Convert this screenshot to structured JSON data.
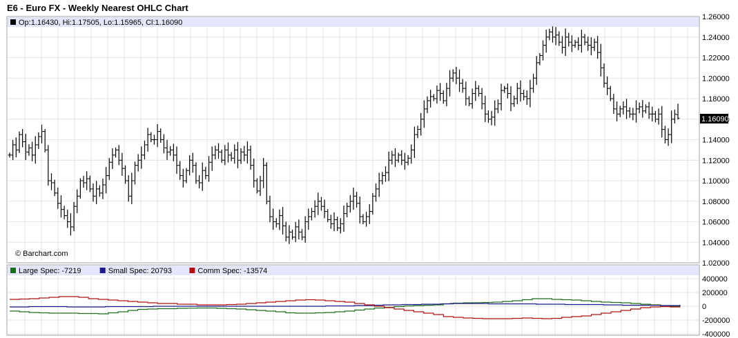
{
  "title": "E6 - Euro FX - Weekly Nearest OHLC Chart",
  "watermark": "© Barchart.com",
  "ohlc_legend": "Op:1.16430, Hi:1.17505, Lo:1.15965, Cl:1.16090",
  "last_price_label": "1.16090",
  "colors": {
    "legend_band": "#e4e6fb",
    "grid": "#e3e3e3",
    "bars": "#000000",
    "large_spec": "#1a6e1a",
    "small_spec": "#1a1a8c",
    "comm_spec": "#b01010"
  },
  "chart_data": [
    {
      "type": "ohlc",
      "yticks": [
        "1.26000",
        "1.24000",
        "1.22000",
        "1.20000",
        "1.18000",
        "1.16000",
        "1.14000",
        "1.12000",
        "1.10000",
        "1.08000",
        "1.06000",
        "1.04000",
        "1.02000"
      ],
      "ylim": [
        1.02,
        1.26
      ],
      "last": {
        "open": 1.1643,
        "high": 1.17505,
        "low": 1.15965,
        "close": 1.1609
      },
      "closes": [
        1.125,
        1.135,
        1.13,
        1.145,
        1.138,
        1.128,
        1.132,
        1.125,
        1.135,
        1.143,
        1.148,
        1.13,
        1.1,
        1.098,
        1.088,
        1.078,
        1.072,
        1.066,
        1.06,
        1.055,
        1.075,
        1.085,
        1.1,
        1.098,
        1.102,
        1.092,
        1.085,
        1.092,
        1.088,
        1.096,
        1.105,
        1.118,
        1.125,
        1.13,
        1.12,
        1.112,
        1.1,
        1.085,
        1.1,
        1.115,
        1.12,
        1.125,
        1.135,
        1.145,
        1.14,
        1.14,
        1.148,
        1.14,
        1.132,
        1.128,
        1.13,
        1.125,
        1.115,
        1.105,
        1.1,
        1.11,
        1.12,
        1.115,
        1.1,
        1.098,
        1.11,
        1.105,
        1.118,
        1.125,
        1.13,
        1.128,
        1.12,
        1.13,
        1.125,
        1.122,
        1.13,
        1.12,
        1.128,
        1.125,
        1.13,
        1.115,
        1.1,
        1.09,
        1.1,
        1.115,
        1.08,
        1.065,
        1.06,
        1.058,
        1.066,
        1.056,
        1.045,
        1.05,
        1.045,
        1.055,
        1.05,
        1.045,
        1.06,
        1.065,
        1.07,
        1.075,
        1.08,
        1.075,
        1.07,
        1.062,
        1.058,
        1.062,
        1.054,
        1.058,
        1.068,
        1.075,
        1.08,
        1.085,
        1.078,
        1.065,
        1.06,
        1.065,
        1.07,
        1.085,
        1.092,
        1.1,
        1.105,
        1.108,
        1.12,
        1.125,
        1.12,
        1.125,
        1.12,
        1.118,
        1.122,
        1.13,
        1.145,
        1.15,
        1.16,
        1.17,
        1.178,
        1.182,
        1.18,
        1.188,
        1.185,
        1.178,
        1.19,
        1.2,
        1.205,
        1.2,
        1.195,
        1.19,
        1.18,
        1.175,
        1.185,
        1.19,
        1.185,
        1.175,
        1.165,
        1.16,
        1.162,
        1.17,
        1.175,
        1.188,
        1.19,
        1.185,
        1.175,
        1.18,
        1.19,
        1.185,
        1.182,
        1.18,
        1.19,
        1.2,
        1.215,
        1.222,
        1.232,
        1.24,
        1.245,
        1.24,
        1.242,
        1.235,
        1.23,
        1.24,
        1.235,
        1.232,
        1.235,
        1.232,
        1.24,
        1.235,
        1.232,
        1.23,
        1.235,
        1.225,
        1.21,
        1.195,
        1.19,
        1.18,
        1.17,
        1.165,
        1.17,
        1.172,
        1.168,
        1.165,
        1.165,
        1.17,
        1.172,
        1.168,
        1.172,
        1.165,
        1.165,
        1.16,
        1.165,
        1.15,
        1.14,
        1.145,
        1.16,
        1.165,
        1.1609
      ]
    },
    {
      "type": "line",
      "yticks": [
        "400000",
        "200000",
        "0",
        "-200000",
        "-400000"
      ],
      "ylim": [
        -400000,
        400000
      ],
      "series": [
        {
          "name": "Large Spec: -7219",
          "color_key": "large_spec",
          "values": [
            -70000,
            -80000,
            -90000,
            -95000,
            -100000,
            -100000,
            -100000,
            -105000,
            -105000,
            -110000,
            -95000,
            -80000,
            -60000,
            -45000,
            -40000,
            -35000,
            -35000,
            -30000,
            -28000,
            -25000,
            -25000,
            -30000,
            -35000,
            -40000,
            -50000,
            -60000,
            -70000,
            -80000,
            -95000,
            -100000,
            -100000,
            -95000,
            -90000,
            -80000,
            -70000,
            -55000,
            -40000,
            -25000,
            -15000,
            -5000,
            5000,
            10000,
            15000,
            20000,
            35000,
            45000,
            50000,
            52000,
            55000,
            60000,
            70000,
            80000,
            95000,
            110000,
            110000,
            100000,
            95000,
            90000,
            80000,
            70000,
            60000,
            55000,
            50000,
            40000,
            30000,
            20000,
            10000,
            0,
            -5000
          ]
        },
        {
          "name": "Small Spec: 20793",
          "color_key": "small_spec",
          "values": [
            -10000,
            -10000,
            -5000,
            -5000,
            -5000,
            -5000,
            -10000,
            -10000,
            -10000,
            -10000,
            -5000,
            -5000,
            -5000,
            -5000,
            -5000,
            0,
            0,
            0,
            0,
            0,
            0,
            0,
            0,
            0,
            0,
            0,
            0,
            0,
            0,
            0,
            0,
            0,
            0,
            5000,
            5000,
            5000,
            10000,
            10000,
            15000,
            20000,
            20000,
            25000,
            25000,
            30000,
            30000,
            35000,
            40000,
            40000,
            40000,
            40000,
            35000,
            35000,
            35000,
            35000,
            35000,
            30000,
            30000,
            30000,
            25000,
            25000,
            25000,
            25000,
            20000,
            20000,
            15000,
            15000,
            15000,
            15000,
            10000,
            10000,
            20793
          ]
        },
        {
          "name": "Comm Spec: -13574",
          "color_key": "comm_spec",
          "values": [
            100000,
            105000,
            110000,
            120000,
            130000,
            140000,
            140000,
            130000,
            110000,
            100000,
            90000,
            80000,
            70000,
            60000,
            50000,
            40000,
            40000,
            30000,
            30000,
            20000,
            20000,
            20000,
            25000,
            30000,
            40000,
            50000,
            60000,
            70000,
            80000,
            90000,
            95000,
            90000,
            80000,
            70000,
            60000,
            40000,
            20000,
            0,
            -20000,
            -40000,
            -60000,
            -80000,
            -100000,
            -120000,
            -150000,
            -160000,
            -170000,
            -175000,
            -180000,
            -180000,
            -180000,
            -175000,
            -170000,
            -175000,
            -180000,
            -175000,
            -160000,
            -150000,
            -140000,
            -120000,
            -100000,
            -80000,
            -60000,
            -40000,
            -20000,
            -10000,
            -5000,
            -10000,
            -13574
          ]
        }
      ]
    }
  ]
}
